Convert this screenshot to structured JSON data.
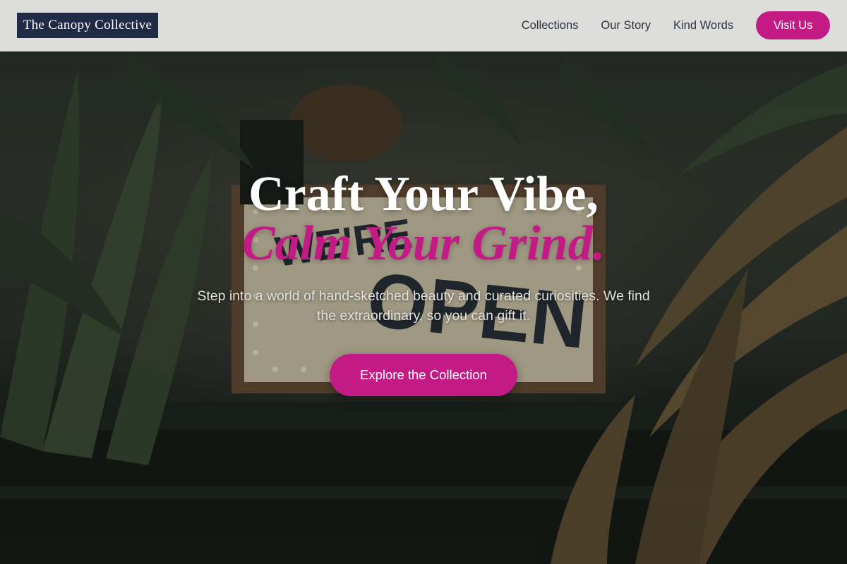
{
  "header": {
    "logo_text": "The Canopy Collective",
    "nav": [
      {
        "label": "Collections"
      },
      {
        "label": "Our Story"
      },
      {
        "label": "Kind Words"
      }
    ],
    "visit_button": "Visit Us"
  },
  "hero": {
    "headline_line1": "Craft Your Vibe,",
    "headline_line2": "Calm Your Grind.",
    "subtitle": "Step into a world of hand-sketched beauty and curated curiosities. We find the extraordinary, so you can gift it.",
    "cta_label": "Explore the Collection",
    "background_image": "plants-and-open-sign-photo"
  },
  "colors": {
    "accent": "#c41a86",
    "logo_bg": "#1f2b45",
    "nav_text": "#2d3340",
    "nav_bg": "#ececea"
  }
}
